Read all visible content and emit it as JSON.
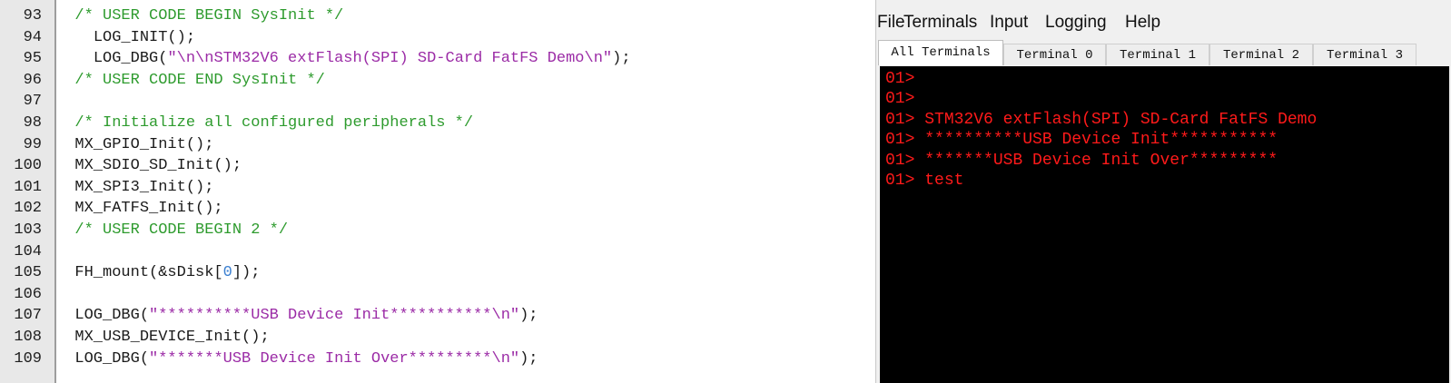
{
  "editor": {
    "line_numbers": [
      "93",
      "94",
      "95",
      "96",
      "97",
      "98",
      "99",
      "100",
      "101",
      "102",
      "103",
      "104",
      "105",
      "106",
      "107",
      "108",
      "109"
    ],
    "lines": [
      {
        "indent": "  ",
        "tokens": [
          {
            "t": "comment",
            "v": "/* USER CODE BEGIN SysInit */"
          }
        ]
      },
      {
        "indent": "    ",
        "tokens": [
          {
            "t": "code",
            "v": "LOG_INIT();"
          }
        ]
      },
      {
        "indent": "    ",
        "tokens": [
          {
            "t": "code",
            "v": "LOG_DBG("
          },
          {
            "t": "string",
            "v": "\"\\n\\nSTM32V6 extFlash(SPI) SD-Card FatFS Demo\\n\""
          },
          {
            "t": "code",
            "v": ");"
          }
        ]
      },
      {
        "indent": "  ",
        "tokens": [
          {
            "t": "comment",
            "v": "/* USER CODE END SysInit */"
          }
        ]
      },
      {
        "indent": "",
        "tokens": []
      },
      {
        "indent": "  ",
        "tokens": [
          {
            "t": "comment",
            "v": "/* Initialize all configured peripherals */"
          }
        ]
      },
      {
        "indent": "  ",
        "tokens": [
          {
            "t": "code",
            "v": "MX_GPIO_Init();"
          }
        ]
      },
      {
        "indent": "  ",
        "tokens": [
          {
            "t": "code",
            "v": "MX_SDIO_SD_Init();"
          }
        ]
      },
      {
        "indent": "  ",
        "tokens": [
          {
            "t": "code",
            "v": "MX_SPI3_Init();"
          }
        ]
      },
      {
        "indent": "  ",
        "tokens": [
          {
            "t": "code",
            "v": "MX_FATFS_Init();"
          }
        ]
      },
      {
        "indent": "  ",
        "tokens": [
          {
            "t": "comment",
            "v": "/* USER CODE BEGIN 2 */"
          }
        ]
      },
      {
        "indent": "",
        "tokens": []
      },
      {
        "indent": "  ",
        "tokens": [
          {
            "t": "code",
            "v": "FH_mount(&sDisk["
          },
          {
            "t": "number",
            "v": "0"
          },
          {
            "t": "code",
            "v": "]);"
          }
        ]
      },
      {
        "indent": "",
        "tokens": []
      },
      {
        "indent": "  ",
        "tokens": [
          {
            "t": "code",
            "v": "LOG_DBG("
          },
          {
            "t": "string",
            "v": "\"**********USB Device Init***********\\n\""
          },
          {
            "t": "code",
            "v": ");"
          }
        ]
      },
      {
        "indent": "  ",
        "tokens": [
          {
            "t": "code",
            "v": "MX_USB_DEVICE_Init();"
          }
        ]
      },
      {
        "indent": "  ",
        "tokens": [
          {
            "t": "code",
            "v": "LOG_DBG("
          },
          {
            "t": "string",
            "v": "\"*******USB Device Init Over*********\\n\""
          },
          {
            "t": "code",
            "v": ");"
          }
        ]
      }
    ]
  },
  "terminal": {
    "menu": [
      "File",
      "Terminals",
      "Input",
      "Logging",
      "Help"
    ],
    "tabs": [
      "All Terminals",
      "Terminal 0",
      "Terminal 1",
      "Terminal 2",
      "Terminal 3"
    ],
    "active_tab": "All Terminals",
    "output": [
      {
        "prefix": "01>",
        "text": ""
      },
      {
        "prefix": "01>",
        "text": ""
      },
      {
        "prefix": "01>",
        "text": "STM32V6 extFlash(SPI) SD-Card FatFS Demo"
      },
      {
        "prefix": "01>",
        "text": "**********USB Device Init***********"
      },
      {
        "prefix": "01>",
        "text": "*******USB Device Init Over*********"
      },
      {
        "prefix": "01>",
        "text": "test"
      }
    ]
  },
  "colors": {
    "comment": "#2e9b2e",
    "string": "#9b2ba6",
    "number": "#3a7fd0",
    "terminal_text": "#ff1a1a",
    "terminal_background": "#000000"
  }
}
